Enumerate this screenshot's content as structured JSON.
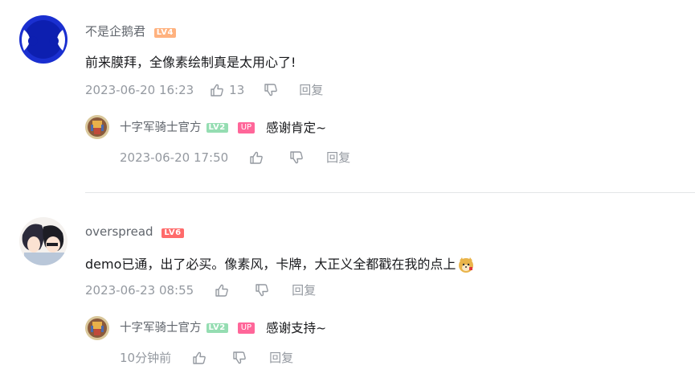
{
  "colors": {
    "lv4": "#ffb27f",
    "lv2": "#95ddb2",
    "lv6": "#ff6b6b",
    "up": "#ff6699",
    "meta": "#9499a0",
    "name": "#61666d"
  },
  "comments": [
    {
      "username": "不是企鹅君",
      "level": "LV4",
      "content": "前来膜拜，全像素绘制真是太用心了!",
      "time": "2023-06-20 16:23",
      "likes": "13",
      "reply_label": "回复",
      "reply": {
        "username": "十字军骑士官方",
        "level": "LV2",
        "badge": "UP",
        "content": "感谢肯定~",
        "time": "2023-06-20 17:50",
        "reply_label": "回复"
      }
    },
    {
      "username": "overspread",
      "level": "LV6",
      "content": "demo已通，出了必买。像素风，卡牌，大正义全都戳在我的点上",
      "emoji": "doge-emoji",
      "time": "2023-06-23 08:55",
      "likes": "",
      "reply_label": "回复",
      "reply": {
        "username": "十字军骑士官方",
        "level": "LV2",
        "badge": "UP",
        "content": "感谢支持~",
        "time": "10分钟前",
        "reply_label": "回复"
      }
    }
  ]
}
